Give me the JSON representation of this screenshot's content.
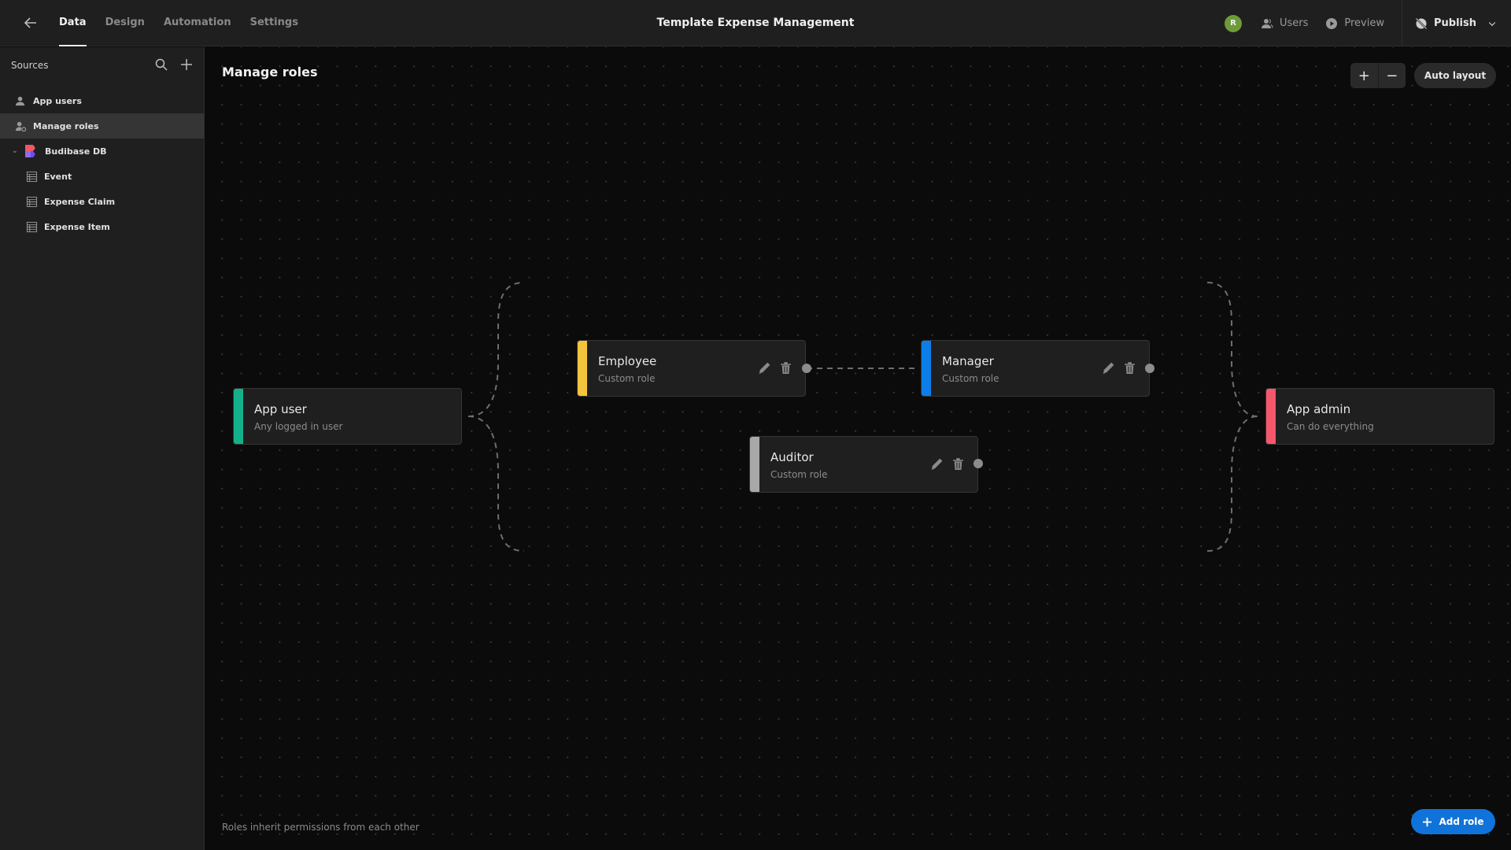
{
  "topbar": {
    "back_icon": "arrow-left-icon",
    "tabs": [
      {
        "label": "Data",
        "active": true
      },
      {
        "label": "Design",
        "active": false
      },
      {
        "label": "Automation",
        "active": false
      },
      {
        "label": "Settings",
        "active": false
      }
    ],
    "app_title": "Template Expense Management",
    "avatar_initial": "R",
    "avatar_color": "#6f9a3a",
    "users_label": "Users",
    "preview_label": "Preview",
    "publish_label": "Publish"
  },
  "sidebar": {
    "heading": "Sources",
    "items": [
      {
        "label": "App users",
        "icon": "users-icon",
        "active": false
      },
      {
        "label": "Manage roles",
        "icon": "user-settings-icon",
        "active": true
      },
      {
        "label": "Budibase DB",
        "icon": "budibase-logo-icon",
        "expanded": true
      },
      {
        "label": "Event",
        "icon": "table-icon"
      },
      {
        "label": "Expense Claim",
        "icon": "table-icon"
      },
      {
        "label": "Expense Item",
        "icon": "table-icon"
      }
    ]
  },
  "main": {
    "title": "Manage roles",
    "zoom_in": "+",
    "zoom_out": "−",
    "auto_layout_label": "Auto layout",
    "footnote": "Roles inherit permissions from each other",
    "add_role_label": "Add role",
    "accent_color": "#0f73d9"
  },
  "roles": [
    {
      "id": "app-user",
      "name": "App user",
      "description": "Any logged in user",
      "color": "#14b08a",
      "editable": false
    },
    {
      "id": "employee",
      "name": "Employee",
      "description": "Custom role",
      "color": "#f2c53d",
      "editable": true
    },
    {
      "id": "manager",
      "name": "Manager",
      "description": "Custom role",
      "color": "#0d7ee8",
      "editable": true
    },
    {
      "id": "auditor",
      "name": "Auditor",
      "description": "Custom role",
      "color": "#a8a8a8",
      "editable": true
    },
    {
      "id": "app-admin",
      "name": "App admin",
      "description": "Can do everything",
      "color": "#f5576c",
      "editable": false
    }
  ],
  "connections": [
    {
      "from": "App user",
      "to": "Employee"
    },
    {
      "from": "App user",
      "to": "Auditor"
    },
    {
      "from": "Employee",
      "to": "Manager"
    },
    {
      "from": "Manager",
      "to": "App admin"
    },
    {
      "from": "Auditor",
      "to": "App admin"
    }
  ]
}
